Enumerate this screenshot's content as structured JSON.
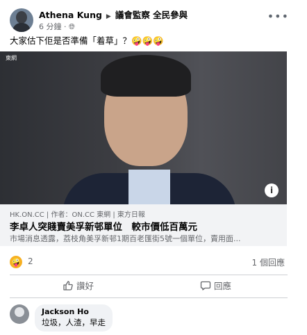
{
  "post": {
    "author": "Athena Kung",
    "group": "議會監察 全民參與",
    "time": "6 分鐘 · ",
    "privacy_icon": "globe-icon",
    "text": "大家估下佢是否準備「着草」？🤪🤪🤪"
  },
  "photo": {
    "watermark": "東網"
  },
  "link": {
    "source": "HK.ON.CC | 作者：ON.CC 東網 | 東方日報",
    "title": "李卓人突賤賣美孚新邨單位　較市價低百萬元",
    "description": "市場消息透露，荔枝角美孚新邨1期百老匯街5號一個單位，賣用面..."
  },
  "stats": {
    "reaction_emoji": "🤪",
    "reaction_count": "2",
    "comment_count": "1 個回應"
  },
  "actions": {
    "like": "讚好",
    "comment": "回應"
  },
  "comment": {
    "author": "Jackson Ho",
    "text": "垃圾，人渣，早走"
  },
  "colors": {
    "accent": "#1877f2",
    "secondary_text": "#65676b",
    "bubble": "#f0f2f5"
  }
}
